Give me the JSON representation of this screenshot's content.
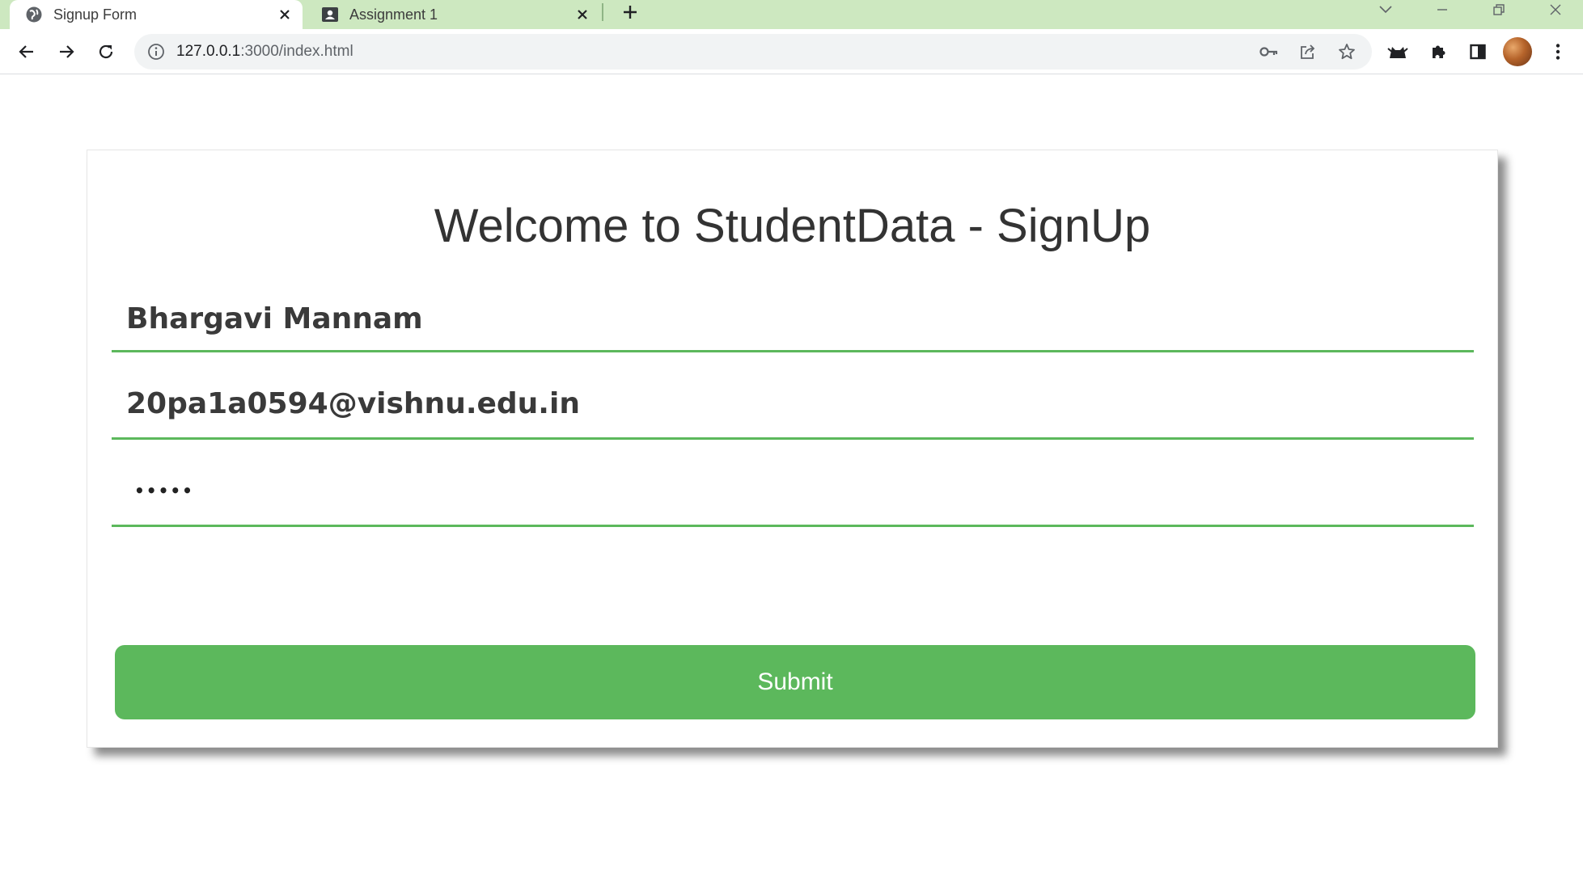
{
  "browser": {
    "tabs": [
      {
        "title": "Signup Form",
        "icon": "globe-icon",
        "active": true
      },
      {
        "title": "Assignment 1",
        "icon": "contact-card-icon",
        "active": false
      }
    ],
    "address_bar": {
      "host": "127.0.0.1",
      "path": ":3000/index.html"
    },
    "accent_color": "#cde8c0"
  },
  "page": {
    "heading": "Welcome to StudentData - SignUp",
    "form": {
      "name_value": "Bhargavi Mannam",
      "email_value": "20pa1a0594@vishnu.edu.in",
      "password_value": "•••••",
      "submit_label": "Submit"
    },
    "colors": {
      "primary": "#5cb85c",
      "heading": "#333333"
    }
  }
}
